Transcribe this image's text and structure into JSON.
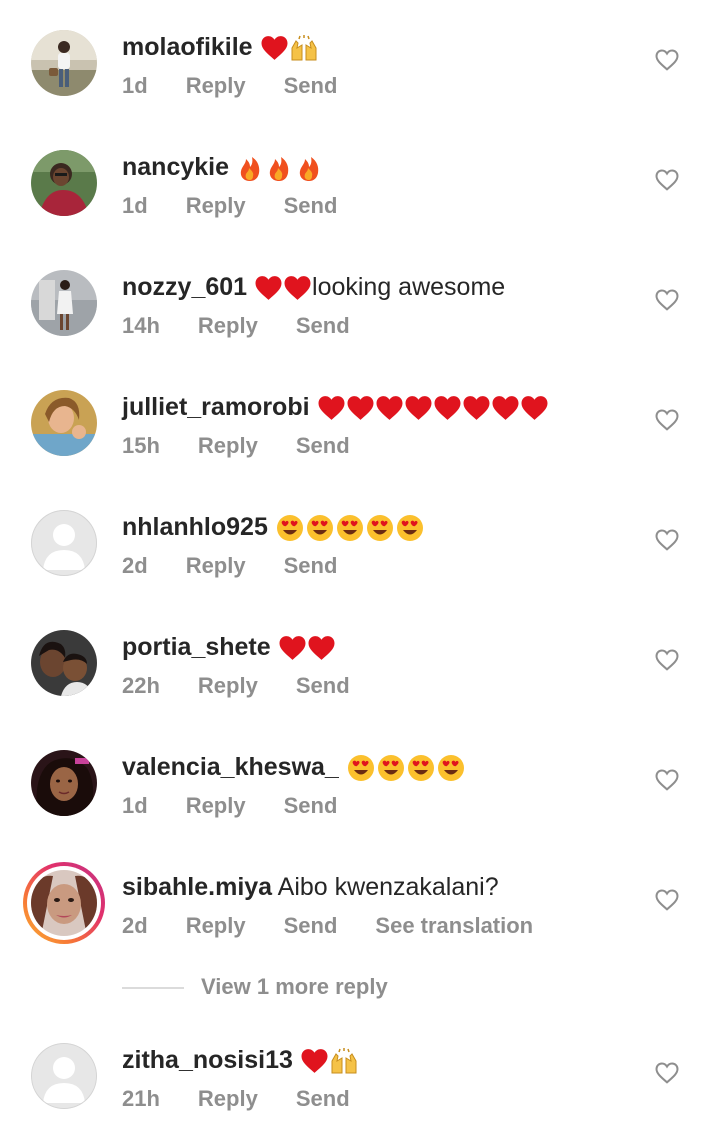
{
  "comments": [
    {
      "username": "molaofikile",
      "text": "",
      "emojis": [
        "heart",
        "raised-hands"
      ],
      "time": "1d",
      "reply": "Reply",
      "send": "Send"
    },
    {
      "username": "nancykie",
      "text": "",
      "emojis": [
        "fire",
        "fire",
        "fire"
      ],
      "time": "1d",
      "reply": "Reply",
      "send": "Send"
    },
    {
      "username": "nozzy_601",
      "text": "looking awesome",
      "emojis": [
        "heart",
        "heart"
      ],
      "time": "14h",
      "reply": "Reply",
      "send": "Send"
    },
    {
      "username": "julliet_ramorobi",
      "text": "",
      "emojis": [
        "heart",
        "heart",
        "heart",
        "heart",
        "heart",
        "heart",
        "heart",
        "heart"
      ],
      "time": "15h",
      "reply": "Reply",
      "send": "Send"
    },
    {
      "username": "nhlanhlo925",
      "text": "",
      "emojis": [
        "heart-eyes",
        "heart-eyes",
        "heart-eyes",
        "heart-eyes",
        "heart-eyes"
      ],
      "time": "2d",
      "reply": "Reply",
      "send": "Send"
    },
    {
      "username": "portia_shete",
      "text": "",
      "emojis": [
        "heart",
        "heart"
      ],
      "time": "22h",
      "reply": "Reply",
      "send": "Send"
    },
    {
      "username": "valencia_kheswa_",
      "text": "",
      "emojis": [
        "heart-eyes",
        "heart-eyes",
        "heart-eyes",
        "heart-eyes"
      ],
      "time": "1d",
      "reply": "Reply",
      "send": "Send"
    },
    {
      "username": "sibahle.miya",
      "text": "Aibo kwenzakalani?",
      "emojis": [],
      "time": "2d",
      "reply": "Reply",
      "send": "Send",
      "see_translation": "See translation"
    },
    {
      "username": "zitha_nosisi13",
      "text": "",
      "emojis": [
        "heart",
        "raised-hands"
      ],
      "time": "21h",
      "reply": "Reply",
      "send": "Send"
    }
  ],
  "view_more_replies": "View 1 more reply",
  "colors": {
    "text_primary": "#262626",
    "text_secondary": "#8e8e8e",
    "heart_red": "#e0141e",
    "divider": "#dbdbdb"
  }
}
